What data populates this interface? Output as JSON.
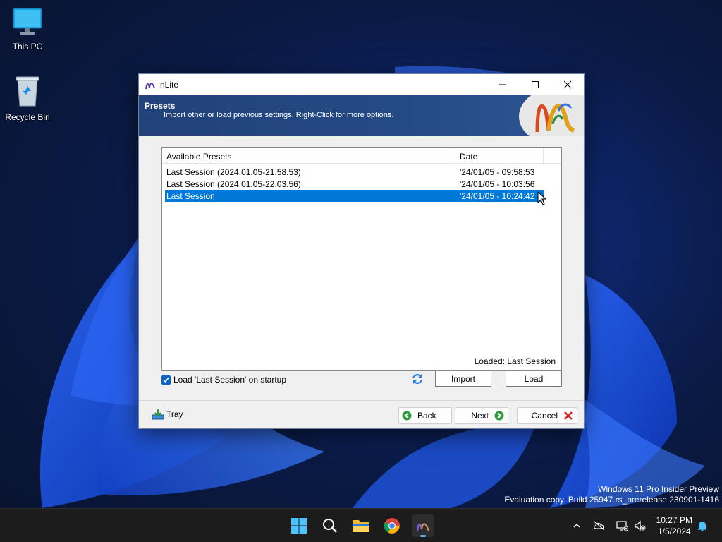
{
  "desktop": {
    "icons": [
      {
        "label": "This PC"
      },
      {
        "label": "Recycle Bin"
      }
    ]
  },
  "window": {
    "title": "nLite",
    "header": {
      "title": "Presets",
      "subtitle": "Import other or load previous settings. Right-Click for more options."
    },
    "list": {
      "columns": [
        "Available Presets",
        "Date"
      ],
      "rows": [
        {
          "name": "Last Session (2024.01.05-21.58.53)",
          "date": "'24/01/05 - 09:58:53",
          "selected": false
        },
        {
          "name": "Last Session (2024.01.05-22.03.56)",
          "date": "'24/01/05 - 10:03:56",
          "selected": false
        },
        {
          "name": "Last Session",
          "date": "'24/01/05 - 10:24:42",
          "selected": true
        }
      ],
      "status": "Loaded: Last Session"
    },
    "startup_checkbox": {
      "label": "Load 'Last Session' on startup",
      "checked": true
    },
    "buttons": {
      "import": "Import",
      "load": "Load",
      "tray": "Tray",
      "back": "Back",
      "next": "Next",
      "cancel": "Cancel"
    }
  },
  "watermark": {
    "line1": "Windows 11 Pro Insider Preview",
    "line2": "Evaluation copy. Build 25947.rs_prerelease.230901-1416"
  },
  "taskbar": {
    "apps": [
      "start-icon",
      "search-icon",
      "file-explorer-icon",
      "chrome-icon",
      "nlite-icon"
    ],
    "active_app": "nlite-icon",
    "time": "10:27 PM",
    "date": "1/5/2024"
  },
  "colors": {
    "selection": "#0078d7",
    "header": "#244a84",
    "taskbar": "#1c1c1c"
  }
}
